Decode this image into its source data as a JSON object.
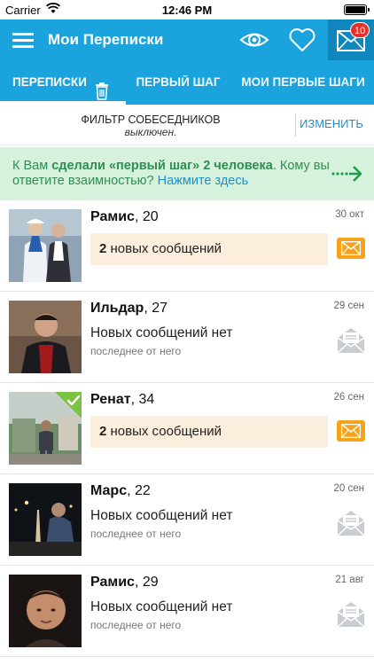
{
  "status_bar": {
    "carrier": "Carrier",
    "time": "12:46 PM"
  },
  "app_bar": {
    "title": "Мои Переписки",
    "mail_badge": "10"
  },
  "tabs": [
    {
      "label": "ПЕРЕПИСКИ",
      "active": true
    },
    {
      "label": "ПЕРВЫЙ ШАГ",
      "active": false
    },
    {
      "label": "МОИ ПЕРВЫЕ ШАГИ",
      "active": false
    }
  ],
  "filter": {
    "title": "ФИЛЬТР СОБЕСЕДНИКОВ",
    "state": "выключен.",
    "change_label": "ИЗМЕНИТЬ"
  },
  "promo": {
    "prefix": "К Вам ",
    "bold": "сделали «первый шаг» 2 человека",
    "middle": ". Кому вы ответите взаимностью? ",
    "link": "Нажмите здесь"
  },
  "conversations": [
    {
      "name": "Рамис",
      "age": ", 20",
      "date": "30 окт",
      "count": "2",
      "status": " новых сообщений",
      "subtext": "",
      "has_new": true
    },
    {
      "name": "Ильдар",
      "age": ", 27",
      "date": "29 сен",
      "count": "",
      "status": "Новых сообщений нет",
      "subtext": "последнее от него",
      "has_new": false
    },
    {
      "name": "Ренат",
      "age": ", 34",
      "date": "26 сен",
      "count": "2",
      "status": " новых сообщений",
      "subtext": "",
      "has_new": true
    },
    {
      "name": "Марс",
      "age": ", 22",
      "date": "20 сен",
      "count": "",
      "status": "Новых сообщений нет",
      "subtext": "последнее от него",
      "has_new": false
    },
    {
      "name": "Рамис",
      "age": ", 29",
      "date": "21 авг",
      "count": "",
      "status": "Новых сообщений нет",
      "subtext": "последнее от него",
      "has_new": false
    }
  ],
  "colors": {
    "primary": "#1aa3dc",
    "accent_orange": "#f7a21b",
    "promo_bg": "#d6f1dc",
    "badge_red": "#e4322b"
  },
  "icons": {
    "menu": "menu-icon",
    "eye": "eye-icon",
    "heart": "heart-icon",
    "mail": "mail-icon",
    "trash": "trash-icon",
    "arrow": "dotted-arrow-icon",
    "envelope_read": "envelope-open-icon",
    "verified": "verified-check-icon"
  }
}
